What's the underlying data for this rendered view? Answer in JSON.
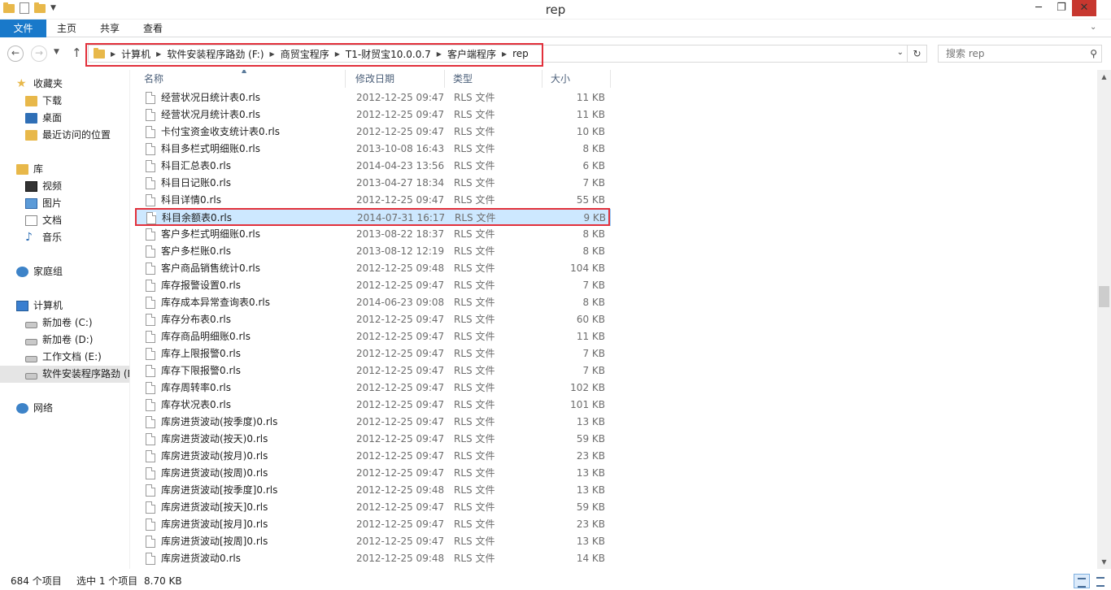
{
  "window": {
    "title": "rep"
  },
  "ribbon": {
    "tabs": [
      "文件",
      "主页",
      "共享",
      "查看"
    ]
  },
  "address": {
    "crumbs": [
      "计算机",
      "软件安装程序路劲 (F:)",
      "商贸宝程序",
      "T1-财贸宝10.0.0.7",
      "客户端程序",
      "rep"
    ]
  },
  "search": {
    "placeholder": "搜索 rep"
  },
  "sidebar": {
    "favorites": "收藏夹",
    "fav_items": [
      "下载",
      "桌面",
      "最近访问的位置"
    ],
    "libraries": "库",
    "lib_items": [
      "视频",
      "图片",
      "文档",
      "音乐"
    ],
    "homegroup": "家庭组",
    "computer": "计算机",
    "drives": [
      "新加卷 (C:)",
      "新加卷 (D:)",
      "工作文档 (E:)",
      "软件安装程序路劲 (F:)"
    ],
    "network": "网络"
  },
  "columns": {
    "name": "名称",
    "date": "修改日期",
    "type": "类型",
    "size": "大小"
  },
  "files": [
    {
      "name": "经营状况日统计表0.rls",
      "date": "2012-12-25 09:47",
      "type": "RLS 文件",
      "size": "11 KB"
    },
    {
      "name": "经营状况月统计表0.rls",
      "date": "2012-12-25 09:47",
      "type": "RLS 文件",
      "size": "11 KB"
    },
    {
      "name": "卡付宝资金收支统计表0.rls",
      "date": "2012-12-25 09:47",
      "type": "RLS 文件",
      "size": "10 KB"
    },
    {
      "name": "科目多栏式明细账0.rls",
      "date": "2013-10-08 16:43",
      "type": "RLS 文件",
      "size": "8 KB"
    },
    {
      "name": "科目汇总表0.rls",
      "date": "2014-04-23 13:56",
      "type": "RLS 文件",
      "size": "6 KB"
    },
    {
      "name": "科目日记账0.rls",
      "date": "2013-04-27 18:34",
      "type": "RLS 文件",
      "size": "7 KB"
    },
    {
      "name": "科目详情0.rls",
      "date": "2012-12-25 09:47",
      "type": "RLS 文件",
      "size": "55 KB"
    },
    {
      "name": "科目余额表0.rls",
      "date": "2014-07-31 16:17",
      "type": "RLS 文件",
      "size": "9 KB",
      "selected": true
    },
    {
      "name": "客户多栏式明细账0.rls",
      "date": "2013-08-22 18:37",
      "type": "RLS 文件",
      "size": "8 KB"
    },
    {
      "name": "客户多栏账0.rls",
      "date": "2013-08-12 12:19",
      "type": "RLS 文件",
      "size": "8 KB"
    },
    {
      "name": "客户商品销售统计0.rls",
      "date": "2012-12-25 09:48",
      "type": "RLS 文件",
      "size": "104 KB"
    },
    {
      "name": "库存报警设置0.rls",
      "date": "2012-12-25 09:47",
      "type": "RLS 文件",
      "size": "7 KB"
    },
    {
      "name": "库存成本异常查询表0.rls",
      "date": "2014-06-23 09:08",
      "type": "RLS 文件",
      "size": "8 KB"
    },
    {
      "name": "库存分布表0.rls",
      "date": "2012-12-25 09:47",
      "type": "RLS 文件",
      "size": "60 KB"
    },
    {
      "name": "库存商品明细账0.rls",
      "date": "2012-12-25 09:47",
      "type": "RLS 文件",
      "size": "11 KB"
    },
    {
      "name": "库存上限报警0.rls",
      "date": "2012-12-25 09:47",
      "type": "RLS 文件",
      "size": "7 KB"
    },
    {
      "name": "库存下限报警0.rls",
      "date": "2012-12-25 09:47",
      "type": "RLS 文件",
      "size": "7 KB"
    },
    {
      "name": "库存周转率0.rls",
      "date": "2012-12-25 09:47",
      "type": "RLS 文件",
      "size": "102 KB"
    },
    {
      "name": "库存状况表0.rls",
      "date": "2012-12-25 09:47",
      "type": "RLS 文件",
      "size": "101 KB"
    },
    {
      "name": "库房进货波动(按季度)0.rls",
      "date": "2012-12-25 09:47",
      "type": "RLS 文件",
      "size": "13 KB"
    },
    {
      "name": "库房进货波动(按天)0.rls",
      "date": "2012-12-25 09:47",
      "type": "RLS 文件",
      "size": "59 KB"
    },
    {
      "name": "库房进货波动(按月)0.rls",
      "date": "2012-12-25 09:47",
      "type": "RLS 文件",
      "size": "23 KB"
    },
    {
      "name": "库房进货波动(按周)0.rls",
      "date": "2012-12-25 09:47",
      "type": "RLS 文件",
      "size": "13 KB"
    },
    {
      "name": "库房进货波动[按季度]0.rls",
      "date": "2012-12-25 09:48",
      "type": "RLS 文件",
      "size": "13 KB"
    },
    {
      "name": "库房进货波动[按天]0.rls",
      "date": "2012-12-25 09:47",
      "type": "RLS 文件",
      "size": "59 KB"
    },
    {
      "name": "库房进货波动[按月]0.rls",
      "date": "2012-12-25 09:47",
      "type": "RLS 文件",
      "size": "23 KB"
    },
    {
      "name": "库房进货波动[按周]0.rls",
      "date": "2012-12-25 09:47",
      "type": "RLS 文件",
      "size": "13 KB"
    },
    {
      "name": "库房进货波动0.rls",
      "date": "2012-12-25 09:48",
      "type": "RLS 文件",
      "size": "14 KB"
    }
  ],
  "status": {
    "count": "684 个项目",
    "selected": "选中 1 个项目",
    "size": "8.70 KB"
  },
  "colors": {
    "accent": "#1979ca",
    "highlight_box": "#e2303b",
    "selection": "#cde8ff"
  }
}
